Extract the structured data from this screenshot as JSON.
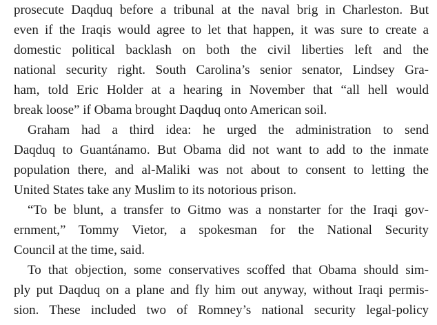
{
  "paragraphs": [
    {
      "indent": false,
      "lines": [
        "prosecute Daqduq before a tribunal at the naval brig in Charleston. But",
        "even if the Iraqis would agree to let that happen, it was sure to create a",
        "domestic political backlash on both the civil liberties left and the",
        "national security right. South Carolina’s senior senator, Lindsey Gra-",
        "ham, told Eric Holder at a hearing in November that “all hell would",
        "break loose” if Obama brought Daqduq onto American soil."
      ]
    },
    {
      "indent": true,
      "lines": [
        "Graham had a third idea: he urged the administration to send",
        "Daqduq to Guantánamo. But Obama did not want to add to the inmate",
        "population there, and al-Maliki was not about to consent to letting the",
        "United States take any Muslim to its notorious prison."
      ]
    },
    {
      "indent": true,
      "lines": [
        "“To be blunt, a transfer to Gitmo was a nonstarter for the Iraqi gov-",
        "ernment,” Tommy Vietor, a spokesman for the National Security",
        "Council at the time, said."
      ]
    },
    {
      "indent": true,
      "lines": [
        "To that objection, some conservatives scoffed that Obama should sim-",
        "ply put Daqduq on a plane and fly him out anyway, without Iraqi permis-",
        "sion. These included two of Romney’s national security legal-policy"
      ]
    }
  ]
}
